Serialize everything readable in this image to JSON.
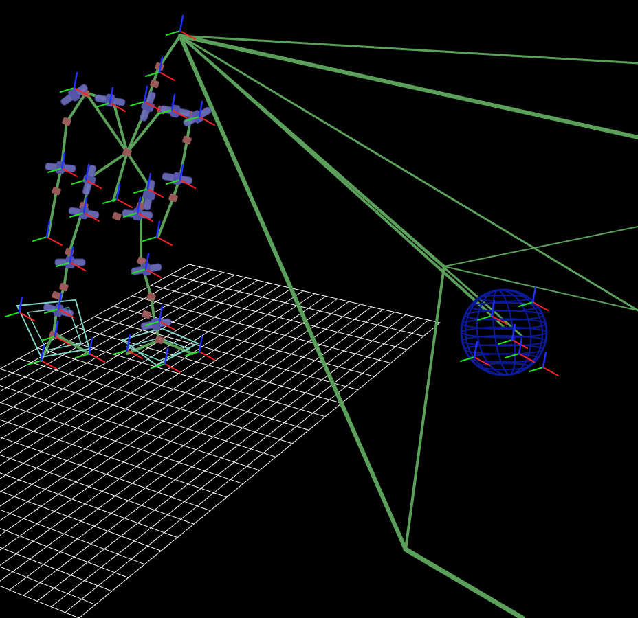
{
  "view": {
    "background": "#000000",
    "colors": {
      "grid": "#ffffff",
      "skeleton": "#5aa05a",
      "joint": "#9a5a5a",
      "frame_box": "#7070c0",
      "foot_box": "#7fd6c8",
      "sphere": "#0a1a9a",
      "axis_x": "#ff2020",
      "axis_y": "#20e020",
      "axis_z": "#2030ff"
    }
  },
  "layers": {
    "grid": "floor-grid",
    "skeleton": "robot-skeleton",
    "rays": "camera-frustum-rays",
    "sphere": "target-wireframe-sphere"
  }
}
